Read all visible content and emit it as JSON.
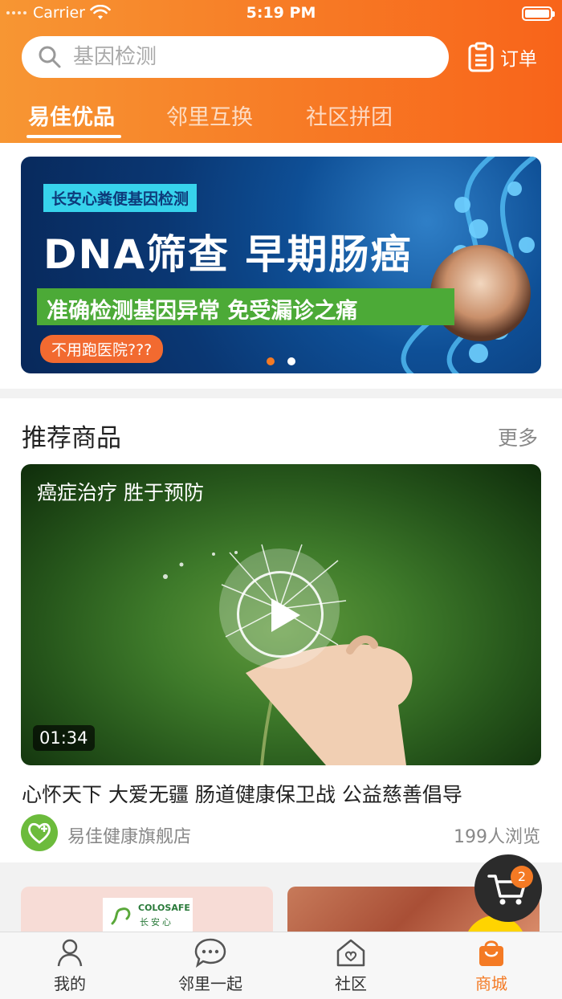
{
  "status_bar": {
    "carrier": "Carrier",
    "time": "5:19 PM"
  },
  "search": {
    "placeholder": "基因检测"
  },
  "header": {
    "order_label": "订单"
  },
  "top_tabs": [
    {
      "label": "易佳优品",
      "active": true
    },
    {
      "label": "邻里互换",
      "active": false
    },
    {
      "label": "社区拼团",
      "active": false
    }
  ],
  "banner": {
    "tag": "长安心粪便基因检测",
    "title": "DNA筛查  早期肠癌",
    "strip": "准确检测基因异常  免受漏诊之痛",
    "pill": "不用跑医院???",
    "page_count": 2,
    "active_index": 0
  },
  "recommended": {
    "title": "推荐商品",
    "more_label": "更多",
    "video": {
      "caption": "癌症治疗 胜于预防",
      "duration": "01:34"
    },
    "product_title": "心怀天下 大爱无疆 肠道健康保卫战 公益慈善倡导",
    "store_name": "易佳健康旗舰店",
    "views": "199人浏览"
  },
  "cards": {
    "card1_logo_text": "COLOSAFE",
    "card1_logo_sub": "长安心"
  },
  "cart": {
    "badge": "2"
  },
  "bottom_nav": [
    {
      "label": "我的",
      "icon": "person-icon",
      "active": false
    },
    {
      "label": "邻里一起",
      "icon": "chat-icon",
      "active": false
    },
    {
      "label": "社区",
      "icon": "home-heart-icon",
      "active": false
    },
    {
      "label": "商城",
      "icon": "shopping-bag-icon",
      "active": true
    }
  ],
  "colors": {
    "accent": "#f47a24",
    "header_start": "#f79633",
    "header_end": "#f8641a",
    "store_green": "#6cbb3c"
  }
}
